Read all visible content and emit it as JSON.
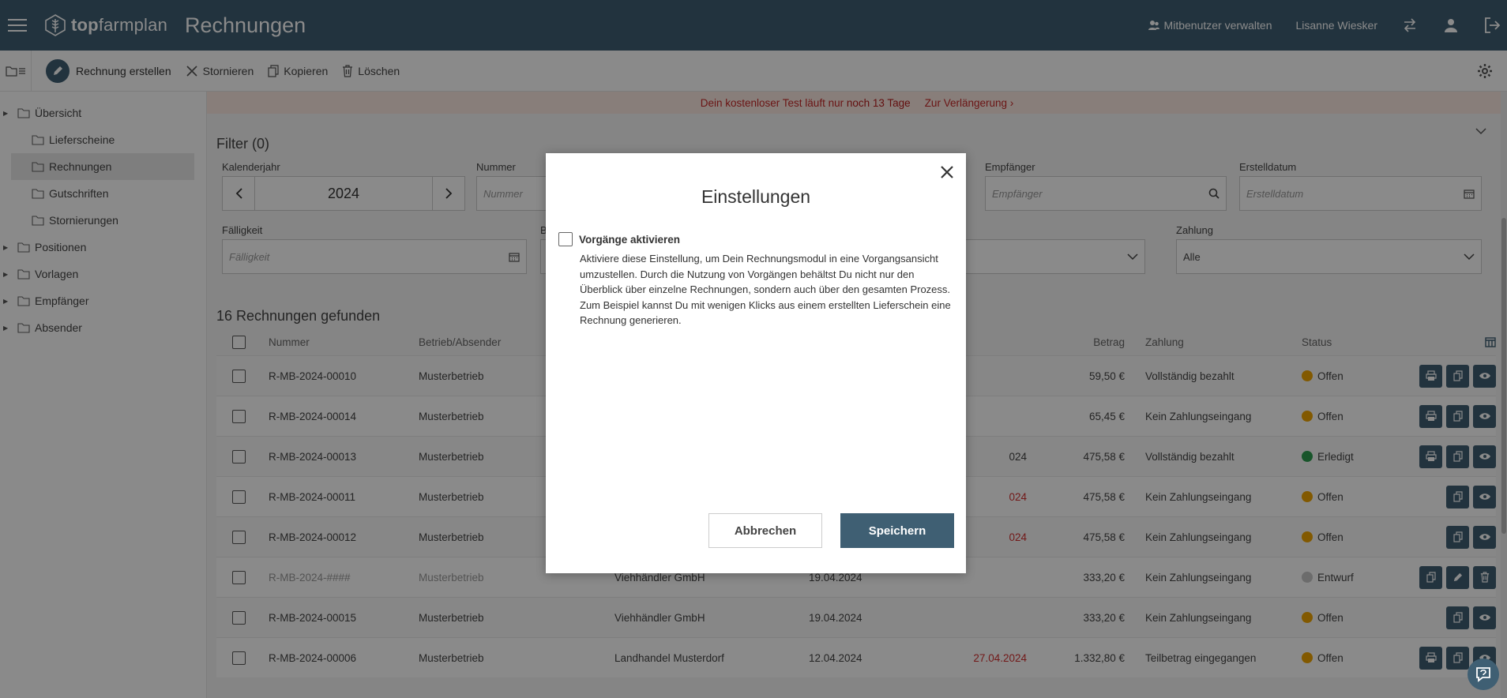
{
  "header": {
    "logo_bold": "top",
    "logo_rest": "farmplan",
    "title": "Rechnungen",
    "manage_users": "Mitbenutzer verwalten",
    "user_name": "Lisanne Wiesker"
  },
  "toolbar": {
    "create": "Rechnung erstellen",
    "cancel": "Stornieren",
    "copy": "Kopieren",
    "delete": "Löschen"
  },
  "sidebar": {
    "items": [
      {
        "label": "Übersicht"
      },
      {
        "label": "Lieferscheine"
      },
      {
        "label": "Rechnungen"
      },
      {
        "label": "Gutschriften"
      },
      {
        "label": "Stornierungen"
      },
      {
        "label": "Positionen"
      },
      {
        "label": "Vorlagen"
      },
      {
        "label": "Empfänger"
      },
      {
        "label": "Absender"
      }
    ]
  },
  "banner": {
    "text": "Dein kostenloser Test läuft nur",
    "highlight": "noch 13 Tage",
    "link": "Zur Verlängerung"
  },
  "filter": {
    "title": "Filter (0)",
    "year_label": "Kalenderjahr",
    "year_value": "2024",
    "number_label": "Nummer",
    "number_placeholder": "Nummer",
    "recipient_label": "Empfänger",
    "recipient_placeholder": "Empfänger",
    "created_label": "Erstelldatum",
    "created_placeholder": "Erstelldatum",
    "due_label": "Fälligkeit",
    "due_placeholder": "Fälligkeit",
    "partial_label": "B",
    "payment_label": "Zahlung",
    "payment_value": "Alle"
  },
  "results": {
    "title": "16 Rechnungen gefunden",
    "columns": {
      "number": "Nummer",
      "company": "Betrieb/Absender",
      "amount": "Betrag",
      "payment": "Zahlung",
      "status": "Status"
    },
    "rows": [
      {
        "number": "R-MB-2024-00010",
        "company": "Musterbetrieb",
        "recipient": "",
        "date": "",
        "due": "",
        "amount": "59,50 €",
        "payment": "Vollständig bezahlt",
        "status": "Offen"
      },
      {
        "number": "R-MB-2024-00014",
        "company": "Musterbetrieb",
        "recipient": "",
        "date": "",
        "due": "",
        "amount": "65,45 €",
        "payment": "Kein Zahlungseingang",
        "status": "Offen"
      },
      {
        "number": "R-MB-2024-00013",
        "company": "Musterbetrieb",
        "recipient": "",
        "date": "",
        "due": "024",
        "amount": "475,58 €",
        "payment": "Vollständig bezahlt",
        "status": "Erledigt"
      },
      {
        "number": "R-MB-2024-00011",
        "company": "Musterbetrieb",
        "recipient": "",
        "date": "",
        "due": "024",
        "amount": "475,58 €",
        "payment": "Kein Zahlungseingang",
        "status": "Offen"
      },
      {
        "number": "R-MB-2024-00012",
        "company": "Musterbetrieb",
        "recipient": "",
        "date": "",
        "due": "024",
        "amount": "475,58 €",
        "payment": "Kein Zahlungseingang",
        "status": "Offen"
      },
      {
        "number": "R-MB-2024-####",
        "company": "Musterbetrieb",
        "recipient": "Viehhändler GmbH",
        "date": "19.04.2024",
        "due": "",
        "amount": "333,20 €",
        "payment": "Kein Zahlungseingang",
        "status": "Entwurf"
      },
      {
        "number": "R-MB-2024-00015",
        "company": "Musterbetrieb",
        "recipient": "Viehhändler GmbH",
        "date": "19.04.2024",
        "due": "",
        "amount": "333,20 €",
        "payment": "Kein Zahlungseingang",
        "status": "Offen"
      },
      {
        "number": "R-MB-2024-00006",
        "company": "Musterbetrieb",
        "recipient": "Landhandel Musterdorf",
        "date": "12.04.2024",
        "due": "27.04.2024",
        "amount": "1.332,80 €",
        "payment": "Teilbetrag eingegangen",
        "status": "Offen"
      }
    ]
  },
  "modal": {
    "title": "Einstellungen",
    "checkbox_label": "Vorgänge aktivieren",
    "description": "Aktiviere diese Einstellung, um Dein Rechnungsmodul in eine Vorgangsansicht umzustellen. Durch die Nutzung von Vorgängen behältst Du nicht nur den Überblick über einzelne Rechnungen, sondern auch über den gesamten Prozess. Zum Beispiel kannst Du mit wenigen Klicks aus einem erstellten Lieferschein eine Rechnung generieren.",
    "cancel": "Abbrechen",
    "save": "Speichern"
  },
  "colors": {
    "primary": "#3f5f73",
    "status_open": "#f0a500",
    "status_done": "#2e9e4f",
    "status_draft": "#c8c8c8",
    "overdue": "#d32f2f"
  }
}
